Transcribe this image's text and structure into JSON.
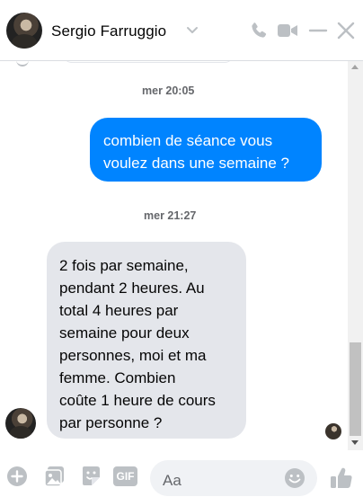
{
  "header": {
    "contact_name": "Sergio Farruggio",
    "icons": [
      "chevron-down-icon",
      "phone-icon",
      "video-camera-icon",
      "minimize-icon",
      "close-icon"
    ]
  },
  "conversation": {
    "messages": [
      {
        "timestamp": "mer 20:05"
      },
      {
        "direction": "outgoing",
        "lines": [
          "combien de séance vous",
          "voulez dans une semaine ?"
        ]
      },
      {
        "timestamp": "mer 21:27"
      },
      {
        "direction": "incoming",
        "lines": [
          "2 fois par semaine,",
          "pendant 2 heures. Au",
          "total 4 heures par",
          "semaine pour deux",
          "personnes, moi et ma",
          "femme. Combien",
          "coûte 1 heure de cours",
          "par personne ?"
        ]
      }
    ]
  },
  "composer": {
    "placeholder": "Aa",
    "gif_label": "GIF",
    "icons": [
      "plus-icon",
      "gallery-icon",
      "sticker-icon",
      "gif-icon",
      "emoji-icon",
      "thumbs-up-icon"
    ]
  },
  "colors": {
    "accent": "#0084ff",
    "incoming_bubble": "#e4e6eb",
    "icon_gray": "#bcc0c4",
    "timestamp_gray": "#65676b"
  }
}
